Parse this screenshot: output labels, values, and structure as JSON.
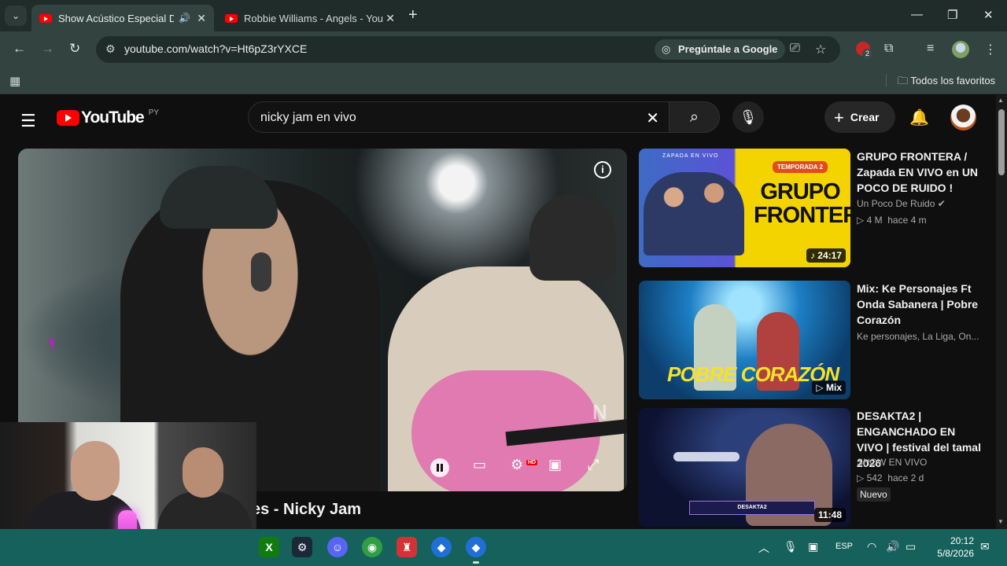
{
  "browser": {
    "tabs": [
      {
        "title": "Show Acústico Especial De",
        "audio": true,
        "active": true
      },
      {
        "title": "Robbie Williams - Angels - You",
        "audio": false,
        "active": false
      }
    ],
    "url": "youtube.com/watch?v=Ht6pZ3rYXCE",
    "ask_google": "Pregúntale a Google",
    "extension_badge": "2",
    "bookmarks_all": "Todos los favoritos"
  },
  "youtube": {
    "logo": "YouTube",
    "country": "PY",
    "search_query": "nicky jam en vivo",
    "create_label": "Crear",
    "video_title_visible": "es - Nicky Jam",
    "player_brand": "N"
  },
  "recommendations": [
    {
      "title": "GRUPO FRONTERA / Zapada EN VIVO en UN POCO DE RUIDO !",
      "channel": "Un Poco De Ruido",
      "verified": true,
      "views": "4 M",
      "age": "hace 4 m",
      "duration": "24:17",
      "thumb_text": "GRUPO FRONTERA",
      "thumb_badge": "TEMPORADA 2",
      "thumb_top": "ZAPADA EN VIVO"
    },
    {
      "title": "Mix: Ke Personajes Ft Onda Sabanera | Pobre Corazón",
      "channel": "Ke personajes, La Liga, On...",
      "badge": "Mix",
      "thumb_text": "POBRE CORAZÓN"
    },
    {
      "title": "DESAKTA2 | ENGANCHADO EN VIVO | festival del tamal 2026",
      "channel": "SHOW EN VIVO",
      "views": "542",
      "age": "hace 2 d",
      "duration": "11:48",
      "new_label": "Nuevo",
      "thumb_text": "DESAKTA2"
    }
  ],
  "taskbar": {
    "language": "ESP",
    "time": "20:12",
    "date": "5/8/2026"
  }
}
